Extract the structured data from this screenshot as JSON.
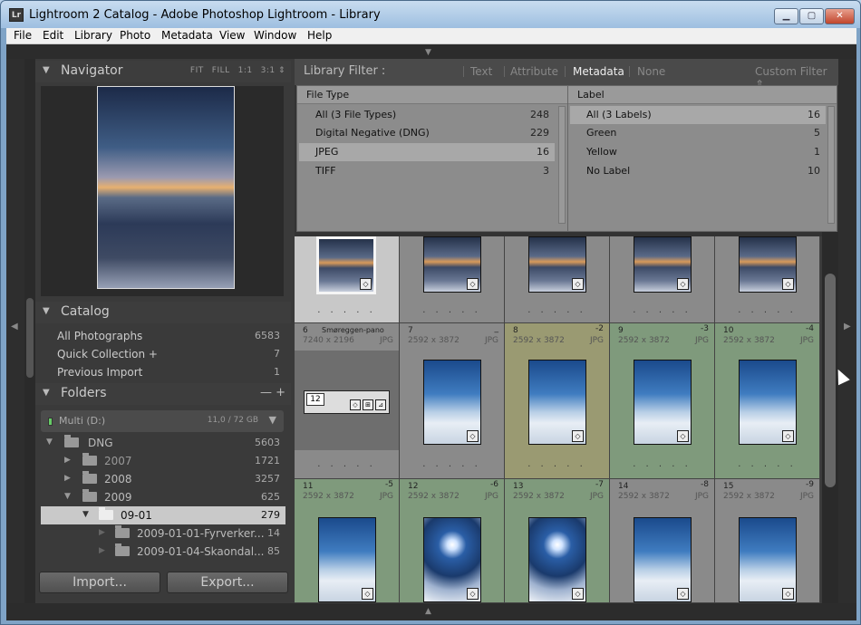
{
  "window": {
    "title": "Lightroom 2 Catalog - Adobe Photoshop Lightroom - Library",
    "app_icon": "Lr",
    "min_glyph": "▁",
    "max_glyph": "▢",
    "close_glyph": "✕"
  },
  "menu": [
    "File",
    "Edit",
    "Library",
    "Photo",
    "Metadata",
    "View",
    "Window",
    "Help"
  ],
  "navigator": {
    "title": "Navigator",
    "options": [
      "FIT",
      "FILL",
      "1:1",
      "3:1 ⇕"
    ]
  },
  "catalog": {
    "title": "Catalog",
    "items": [
      {
        "label": "All Photographs",
        "count": "6583"
      },
      {
        "label": "Quick Collection  +",
        "count": "7"
      },
      {
        "label": "Previous Import",
        "count": "1"
      }
    ]
  },
  "folders": {
    "title": "Folders",
    "controls": "—  +",
    "volume": {
      "label": "Multi (D:)",
      "size": "11,0 / 72 GB",
      "dropdown": "▼"
    },
    "rows": [
      {
        "label": "DNG",
        "count": "5603",
        "tri": "▼"
      },
      {
        "label": "2007",
        "count": "1721",
        "tri": "▶"
      },
      {
        "label": "2008",
        "count": "3257",
        "tri": "▶"
      },
      {
        "label": "2009",
        "count": "625",
        "tri": "▼"
      },
      {
        "label": "09-01",
        "count": "279",
        "tri": "▼"
      },
      {
        "label": "2009-01-01-Fyrverker...",
        "count": "14",
        "tri": "▶"
      },
      {
        "label": "2009-01-04-Skaondal...",
        "count": "85",
        "tri": "▶"
      }
    ]
  },
  "buttons": {
    "import": "Import...",
    "export": "Export..."
  },
  "filter": {
    "title": "Library Filter :",
    "options": [
      "Text",
      "Attribute",
      "Metadata",
      "None"
    ],
    "preset": "Custom Filter ⇕"
  },
  "metadata": {
    "file_type": {
      "header": "File Type",
      "rows": [
        {
          "label": "All (3 File Types)",
          "count": "248"
        },
        {
          "label": "Digital Negative (DNG)",
          "count": "229"
        },
        {
          "label": "JPEG",
          "count": "16"
        },
        {
          "label": "TIFF",
          "count": "3"
        }
      ]
    },
    "label": {
      "header": "Label",
      "rows": [
        {
          "label": "All (3 Labels)",
          "count": "16"
        },
        {
          "label": "Green",
          "count": "5"
        },
        {
          "label": "Yellow",
          "count": "1"
        },
        {
          "label": "No Label",
          "count": "10"
        }
      ]
    }
  },
  "grid": {
    "dots": ". . . . .",
    "stack_count": "12",
    "row2": [
      {
        "num": "6",
        "name": "Smøreggen-pano",
        "seq": "",
        "dims": "7240 x 2196",
        "ext": "JPG"
      },
      {
        "num": "7",
        "name": "",
        "seq": "_",
        "dims": "2592 x 3872",
        "ext": "JPG"
      },
      {
        "num": "8",
        "name": "",
        "seq": "-2",
        "dims": "2592 x 3872",
        "ext": "JPG"
      },
      {
        "num": "9",
        "name": "",
        "seq": "-3",
        "dims": "2592 x 3872",
        "ext": "JPG"
      },
      {
        "num": "10",
        "name": "",
        "seq": "-4",
        "dims": "2592 x 3872",
        "ext": "JPG"
      }
    ],
    "row3": [
      {
        "num": "11",
        "name": "",
        "seq": "-5",
        "dims": "2592 x 3872",
        "ext": "JPG"
      },
      {
        "num": "12",
        "name": "",
        "seq": "-6",
        "dims": "2592 x 3872",
        "ext": "JPG"
      },
      {
        "num": "13",
        "name": "",
        "seq": "-7",
        "dims": "2592 x 3872",
        "ext": "JPG"
      },
      {
        "num": "14",
        "name": "",
        "seq": "-8",
        "dims": "2592 x 3872",
        "ext": "JPG"
      },
      {
        "num": "15",
        "name": "",
        "seq": "-9",
        "dims": "2592 x 3872",
        "ext": "JPG"
      }
    ]
  },
  "colors": {
    "green_label": "#7f9a7c",
    "yellow_label": "#9a9a72",
    "selected_cell": "#c8c8c8"
  }
}
